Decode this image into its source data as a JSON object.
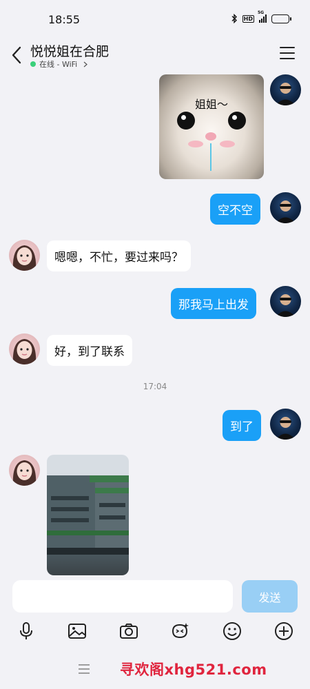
{
  "status_bar": {
    "time": "18:55",
    "hd_label": "HD",
    "network_label": "5G"
  },
  "header": {
    "contact_name": "悦悦姐在合肥",
    "presence": "在线 - WiFi"
  },
  "messages": [
    {
      "type": "image",
      "side": "out",
      "caption": "姐姐～"
    },
    {
      "type": "text",
      "side": "out",
      "text": "空不空"
    },
    {
      "type": "text",
      "side": "in",
      "text": "嗯嗯，不忙，要过来吗？"
    },
    {
      "type": "text",
      "side": "out",
      "text": "那我马上出发"
    },
    {
      "type": "text",
      "side": "in",
      "text": "好，到了联系"
    },
    {
      "type": "time",
      "text": "17:04"
    },
    {
      "type": "text",
      "side": "out",
      "text": "到了"
    },
    {
      "type": "image",
      "side": "in",
      "caption": ""
    }
  ],
  "composer": {
    "placeholder": "",
    "send_label": "发送"
  },
  "toolbar": [
    "microphone-icon",
    "image-icon",
    "camera-icon",
    "sticker-icon",
    "emoji-icon",
    "plus-icon"
  ],
  "watermark": "寻欢阁xhg521.com",
  "colors": {
    "outgoing_bubble": "#1aa0f7",
    "incoming_bubble": "#ffffff",
    "send_button": "#99cff5",
    "online": "#3ad07a",
    "watermark": "#e0253e"
  }
}
